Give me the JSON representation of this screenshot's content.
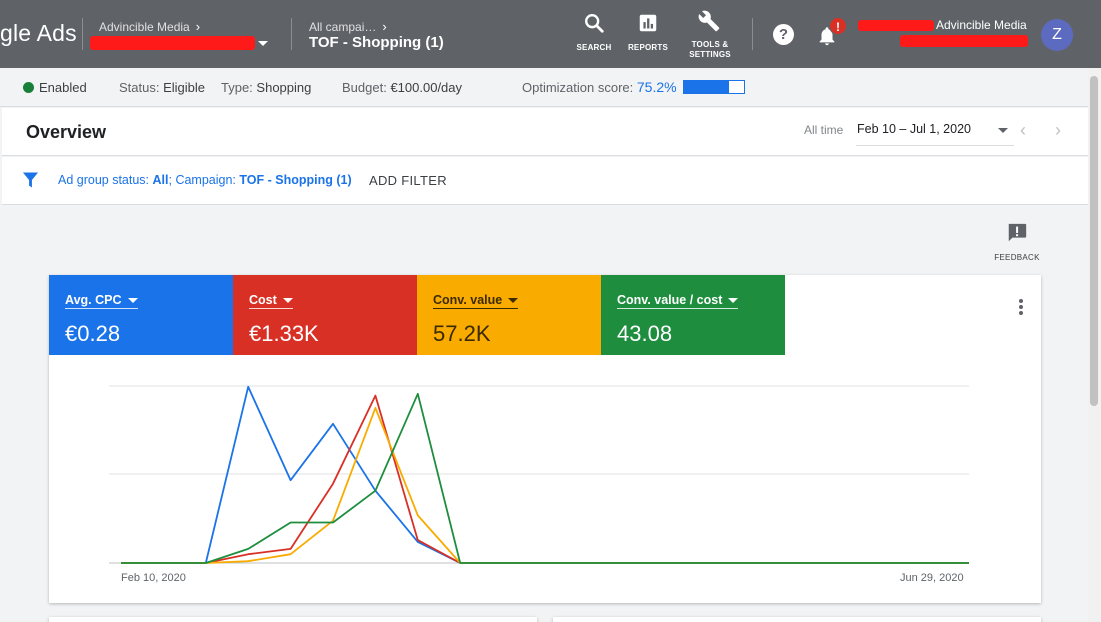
{
  "header": {
    "brand": "gle Ads",
    "account": {
      "label": "Advincible Media"
    },
    "campaign": {
      "parent": "All campai…",
      "name": "TOF - Shopping (1)"
    },
    "tools": [
      {
        "icon": "search-icon",
        "label": "SEARCH"
      },
      {
        "icon": "reports-icon",
        "label": "REPORTS"
      },
      {
        "icon": "wrench-icon",
        "label_line1": "TOOLS &",
        "label_line2": "SETTINGS"
      }
    ],
    "help_glyph": "?",
    "notification_badge": "!",
    "user_name": "Advincible Media",
    "avatar_letter": "Z"
  },
  "status": {
    "enabled": "Enabled",
    "status_label": "Status:",
    "status_value": "Eligible",
    "type_label": "Type:",
    "type_value": "Shopping",
    "budget_label": "Budget:",
    "budget_value": "€100.00/day",
    "opt_label": "Optimization score:",
    "opt_value": "75.2%",
    "opt_fraction": 0.752,
    "enabled_color": "#188038"
  },
  "overview": {
    "title": "Overview",
    "all_time": "All time",
    "date_range": "Feb 10 – Jul 1, 2020",
    "prev_glyph": "‹",
    "next_glyph": "›"
  },
  "filter": {
    "status_label": "Ad group status:",
    "status_value": "All",
    "campaign_label": "; Campaign:",
    "campaign_value": "TOF - Shopping (1)",
    "add_filter": "ADD FILTER"
  },
  "feedback": {
    "label": "FEEDBACK"
  },
  "metrics": [
    {
      "label": "Avg. CPC",
      "value": "€0.28",
      "color": "#1a73e8"
    },
    {
      "label": "Cost",
      "value": "€1.33K",
      "color": "#d93025"
    },
    {
      "label": "Conv. value",
      "value": "57.2K",
      "color": "#f9ab00"
    },
    {
      "label": "Conv. value / cost",
      "value": "43.08",
      "color": "#1e8e3e"
    }
  ],
  "chart_data": {
    "type": "line",
    "x_start_label": "Feb 10, 2020",
    "x_end_label": "Jun 29, 2020",
    "x": [
      0,
      1,
      2,
      3,
      4,
      5,
      6,
      7,
      8,
      9,
      10,
      11,
      12,
      13,
      14,
      15,
      16,
      17,
      18,
      19,
      20
    ],
    "ylim": [
      0,
      1
    ],
    "grid": true,
    "series": [
      {
        "color": "#1a73e8",
        "values": [
          0,
          0,
          0,
          1.0,
          0.47,
          0.79,
          0.41,
          0.12,
          0,
          0,
          0,
          0,
          0,
          0,
          0,
          0,
          0,
          0,
          0,
          0,
          0
        ]
      },
      {
        "color": "#d93025",
        "values": [
          0,
          0,
          0,
          0.05,
          0.08,
          0.45,
          0.95,
          0.13,
          0,
          0,
          0,
          0,
          0,
          0,
          0,
          0,
          0,
          0,
          0,
          0,
          0
        ]
      },
      {
        "color": "#f9ab00",
        "values": [
          0,
          0,
          0,
          0.01,
          0.05,
          0.24,
          0.88,
          0.27,
          0,
          0,
          0,
          0,
          0,
          0,
          0,
          0,
          0,
          0,
          0,
          0,
          0
        ]
      },
      {
        "color": "#1e8e3e",
        "values": [
          0,
          0,
          0,
          0.08,
          0.23,
          0.23,
          0.41,
          0.96,
          0,
          0,
          0,
          0,
          0,
          0,
          0,
          0,
          0,
          0,
          0,
          0,
          0
        ]
      }
    ]
  }
}
